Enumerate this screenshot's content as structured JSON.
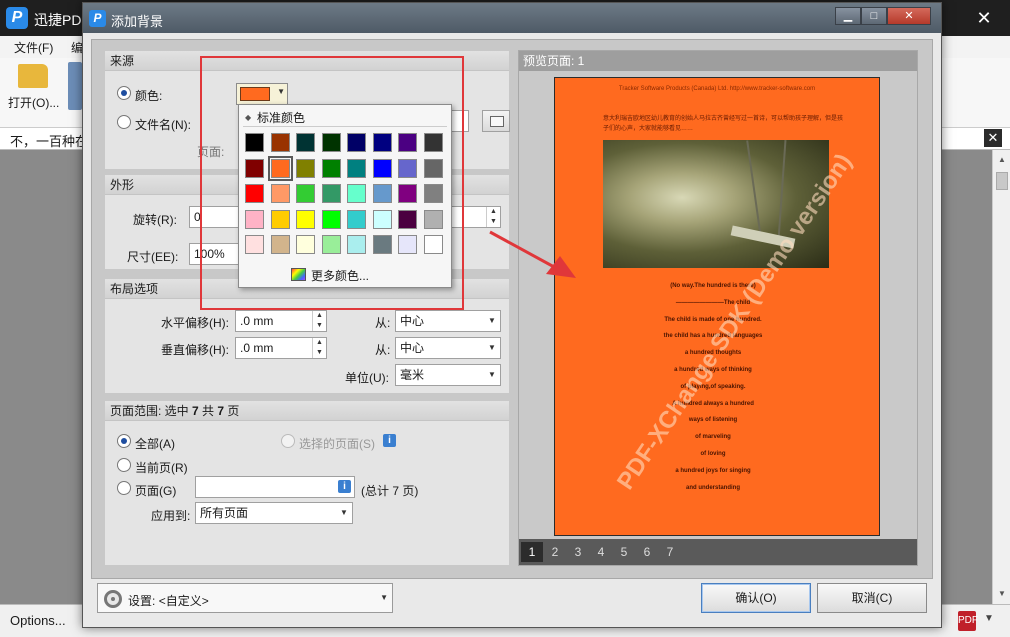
{
  "app": {
    "title": "迅捷PD",
    "close_glyph": "✕",
    "menu": [
      "文件(F)",
      "编"
    ],
    "ribbon_open_label": "打开(O)...",
    "tab_title": "不，一百种在",
    "tab_close_glyph": "✕",
    "status_options": "Options...",
    "status_pdf_label": "PDF"
  },
  "dialog": {
    "title": "添加背景",
    "window_buttons": {
      "minimize": "▁",
      "maximize": "□",
      "close": "✕"
    },
    "source": {
      "header": "来源",
      "color_label": "颜色:",
      "file_label": "文件名(N):",
      "page_label": "页面:",
      "selected_color": "#ff6a1f",
      "source_selected": "color"
    },
    "appearance": {
      "header": "外形",
      "rotation_label": "旋转(R):",
      "rotation_value": "0",
      "size_label": "尺寸(EE):",
      "size_value": "100%"
    },
    "layout": {
      "header": "布局选项",
      "h_offset_label": "水平偏移(H):",
      "h_offset_value": ".0 mm",
      "v_offset_label": "垂直偏移(H):",
      "v_offset_value": ".0 mm",
      "from_label": "从:",
      "h_from_value": "中心",
      "v_from_value": "中心",
      "unit_label": "单位(U):",
      "unit_value": "毫米"
    },
    "page_range": {
      "header_prefix": "页面范围: 选中 ",
      "header_selected": "7",
      "header_middle": " 共 ",
      "header_total": "7",
      "header_suffix": " 页",
      "all_label": "全部(A)",
      "selected_pages_label": "选择的页面(S)",
      "current_label": "当前页(R)",
      "pages_label": "页面(G)",
      "pages_total": "(总计 7 页)",
      "apply_to_label": "应用到:",
      "apply_to_value": "所有页面",
      "info_glyph": "i",
      "range_selected": "all"
    },
    "palette": {
      "title": "标准颜色",
      "more_colors": "更多颜色...",
      "selected_index": 9,
      "colors": [
        "#000000",
        "#993300",
        "#003333",
        "#003300",
        "#000066",
        "#000080",
        "#4b0082",
        "#333333",
        "#800000",
        "#ff6a1f",
        "#808000",
        "#008000",
        "#008080",
        "#0000ff",
        "#6666cc",
        "#666666",
        "#ff0000",
        "#ff9966",
        "#33cc33",
        "#339966",
        "#66ffcc",
        "#6699cc",
        "#800080",
        "#808080",
        "#ffb3c6",
        "#ffcc00",
        "#ffff00",
        "#00ff00",
        "#33cccc",
        "#ccffff",
        "#4b0040",
        "#b0b0b0",
        "#ffe0e0",
        "#d2b48c",
        "#ffffdd",
        "#99ee99",
        "#aaeeee",
        "#6a7a80",
        "#e6e6fa",
        "#ffffff"
      ]
    },
    "preview": {
      "header": "预览页面: 1",
      "page_header_line": "Tracker Software Products (Canada) Ltd. http://www.tracker-software.com",
      "page_paragraph": "意大利瑞吉欧地区幼儿教育的创始人马拉古齐曾经写过一首诗，可以帮助孩子理解，但是孩子们的心声，大家就能够看见……",
      "poem": [
        "(No way.The hundred is there)",
        "————————The child",
        "The child is made of one hundred.",
        "the child has a hundred languages",
        "a hundred thoughts",
        "a hundred ways of thinking",
        "of playing,of speaking.",
        "A hundred always a hundred",
        "ways of listening",
        "of marveling",
        "of loving",
        "a hundred joys for singing",
        "and understanding"
      ],
      "watermark": "PDF-XChange SDK (Demo version)",
      "pages": [
        "1",
        "2",
        "3",
        "4",
        "5",
        "6",
        "7"
      ],
      "active_page": "1"
    },
    "footer": {
      "settings_label": "设置:",
      "settings_value": "<自定义>",
      "ok_label": "确认(O)",
      "cancel_label": "取消(C)"
    }
  },
  "annotation": {
    "color": "#e0373a"
  }
}
